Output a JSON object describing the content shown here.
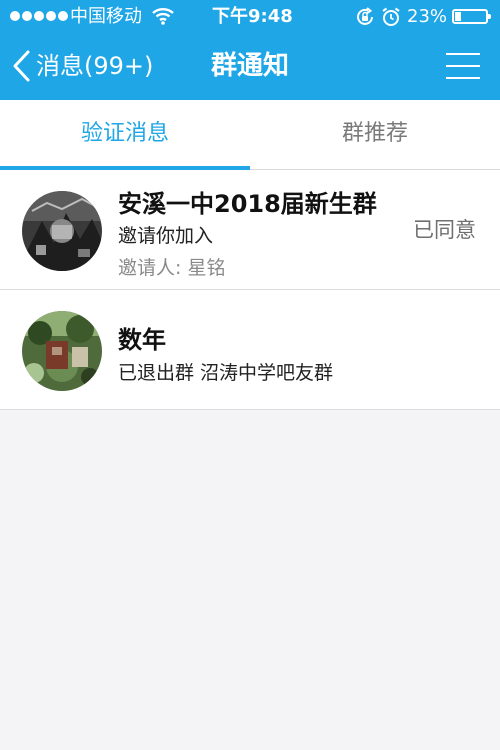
{
  "status_bar": {
    "carrier": "中国移动",
    "time": "下午9:48",
    "battery_percent": "23%",
    "battery_level": 0.23
  },
  "nav": {
    "back_label": "消息(99+)",
    "title": "群通知"
  },
  "tabs": [
    {
      "label": "验证消息",
      "active": true
    },
    {
      "label": "群推荐",
      "active": false
    }
  ],
  "notifications": [
    {
      "name": "安溪一中2018届新生群",
      "line": "邀请你加入",
      "inviter": "邀请人:  星铭",
      "status": "已同意"
    },
    {
      "name": "数年",
      "line": "已退出群 沼涛中学吧友群"
    }
  ],
  "colors": {
    "accent": "#1ea6e6",
    "page_background": "#f4f4f6"
  }
}
